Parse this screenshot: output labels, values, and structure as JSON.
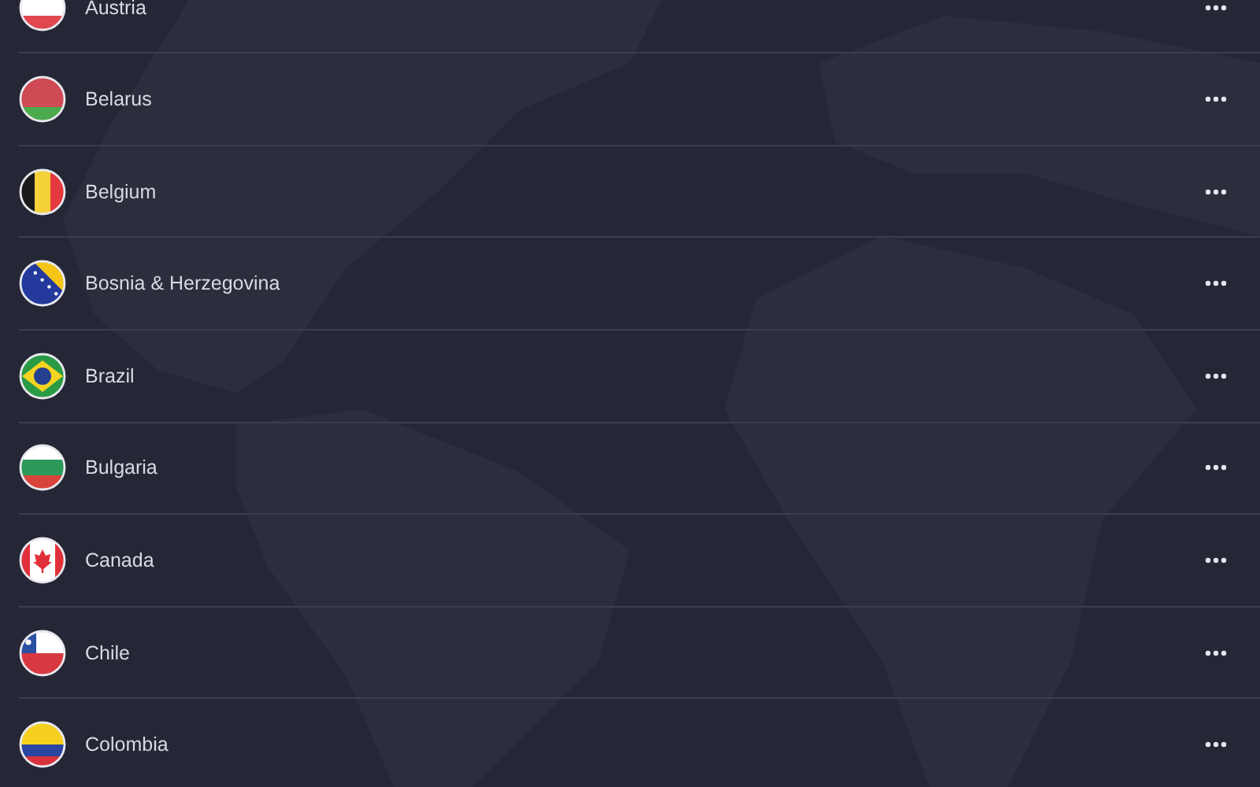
{
  "countries": [
    {
      "name": "Austria",
      "kind": "at"
    },
    {
      "name": "Belarus",
      "kind": "by"
    },
    {
      "name": "Belgium",
      "kind": "be"
    },
    {
      "name": "Bosnia & Herzegovina",
      "kind": "ba"
    },
    {
      "name": "Brazil",
      "kind": "br"
    },
    {
      "name": "Bulgaria",
      "kind": "bg"
    },
    {
      "name": "Canada",
      "kind": "ca"
    },
    {
      "name": "Chile",
      "kind": "cl"
    },
    {
      "name": "Colombia",
      "kind": "co"
    }
  ]
}
